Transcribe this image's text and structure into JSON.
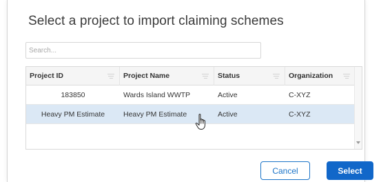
{
  "dialog": {
    "title": "Select a project to import claiming schemes"
  },
  "search": {
    "placeholder": "Search...",
    "value": ""
  },
  "grid": {
    "columns": [
      "Project ID",
      "Project Name",
      "Status",
      "Organization"
    ],
    "rows": [
      {
        "id": "183850",
        "name": "Wards Island WWTP",
        "status": "Active",
        "org": "C-XYZ",
        "selected": false
      },
      {
        "id": "Heavy PM Estimate",
        "name": "Heavy PM Estimate",
        "status": "Active",
        "org": "C-XYZ",
        "selected": true
      }
    ]
  },
  "buttons": {
    "cancel": "Cancel",
    "select": "Select"
  },
  "colors": {
    "accent": "#1167c9",
    "selected_row": "#dbe8f5",
    "header_bg": "#f5f5f5"
  },
  "icons": [
    "column-menu-icon",
    "scroll-down-arrow-icon",
    "hand-pointer-cursor-icon"
  ]
}
